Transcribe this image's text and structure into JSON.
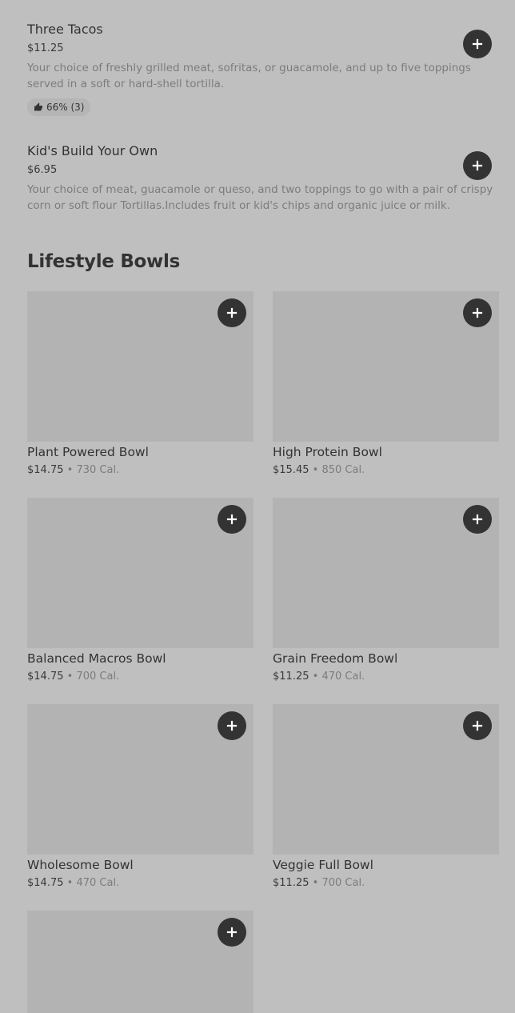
{
  "items": [
    {
      "title": "Three Tacos",
      "price": "$11.25",
      "description": "Your choice of freshly grilled meat, sofritas, or guacamole, and up to five toppings served in a soft or hard-shell tortilla.",
      "rating": "66% (3)"
    },
    {
      "title": "Kid's Build Your Own",
      "price": "$6.95",
      "description": "Your choice of meat, guacamole or queso, and two toppings to go with a pair of crispy corn or soft flour Tortillas.Includes fruit or kid's chips and organic juice or milk."
    }
  ],
  "section": {
    "title": "Lifestyle Bowls"
  },
  "bowls": [
    {
      "title": "Plant Powered Bowl",
      "price": "$14.75",
      "separator": "•",
      "calories": "730 Cal."
    },
    {
      "title": "High Protein Bowl",
      "price": "$15.45",
      "separator": "•",
      "calories": "850 Cal."
    },
    {
      "title": "Balanced Macros Bowl",
      "price": "$14.75",
      "separator": "•",
      "calories": "700 Cal."
    },
    {
      "title": "Grain Freedom Bowl",
      "price": "$11.25",
      "separator": "•",
      "calories": "470 Cal."
    },
    {
      "title": "Wholesome Bowl",
      "price": "$14.75",
      "separator": "•",
      "calories": "470 Cal."
    },
    {
      "title": "Veggie Full Bowl",
      "price": "$11.25",
      "separator": "•",
      "calories": "700 Cal."
    },
    {}
  ],
  "icons": {
    "add": "plus-icon",
    "rating": "thumbs-up-icon"
  },
  "colors": {
    "background": "#bfbfbf",
    "add_button": "#333333",
    "image_placeholder": "#b3b3b3"
  }
}
